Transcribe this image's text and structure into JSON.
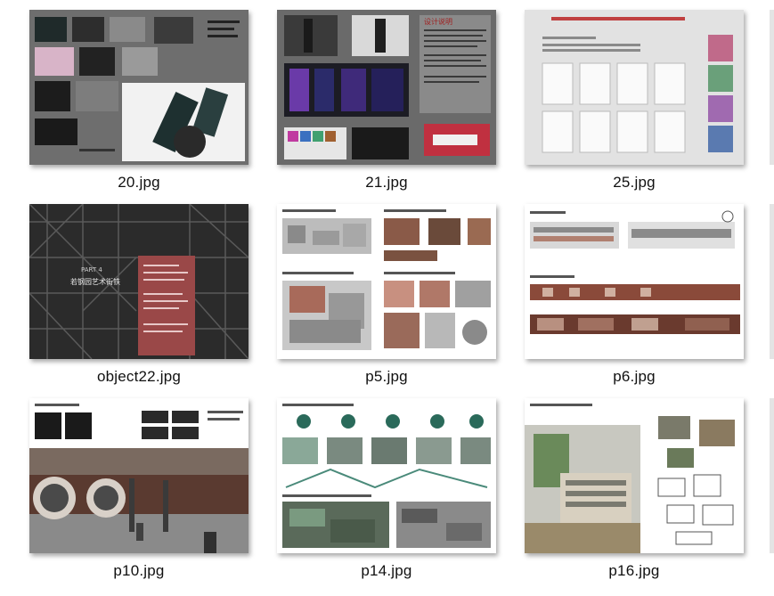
{
  "files": [
    {
      "name": "20.jpg",
      "thumb": "packaging-board-dark"
    },
    {
      "name": "21.jpg",
      "thumb": "packaging-board-bottles"
    },
    {
      "name": "25.jpg",
      "thumb": "certificate-grid"
    },
    {
      "name": "object22.jpg",
      "thumb": "steel-scaffold-poster"
    },
    {
      "name": "p5.jpg",
      "thumb": "architecture-sketch-sheet"
    },
    {
      "name": "p6.jpg",
      "thumb": "elevation-drawing-sheet"
    },
    {
      "name": "p10.jpg",
      "thumb": "interior-render-sheet"
    },
    {
      "name": "p14.jpg",
      "thumb": "analysis-diagram-sheet"
    },
    {
      "name": "p16.jpg",
      "thumb": "building-render-sheet"
    }
  ],
  "thumb_text": {
    "tag_design": "设计说明",
    "poster_part": "PART 4",
    "poster_title": "若钢园艺术街铁"
  }
}
